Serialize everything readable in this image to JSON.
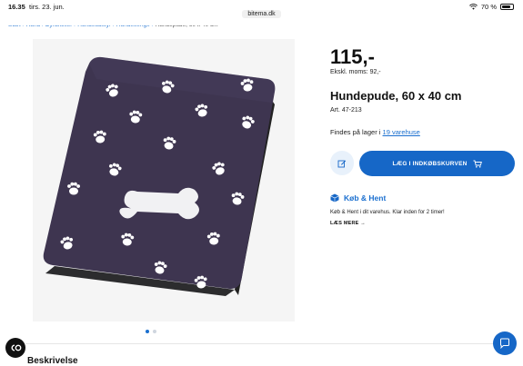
{
  "statusbar": {
    "time": "16.35",
    "date": "tirs. 23. jun.",
    "battery": "70 %"
  },
  "browser": {
    "domain": "bitema.dk"
  },
  "breadcrumb": {
    "items": [
      "Start",
      "Hund",
      "Dyrartikler",
      "Hundeudstyr",
      "Hundesenge"
    ],
    "current": "Hundepude, 60 x 40 cm"
  },
  "gallery": {
    "pages": 2,
    "active": 1
  },
  "product": {
    "price": "115,-",
    "ex_moms_label": "Ekskl. moms:",
    "ex_moms_value": "92,-",
    "title": "Hundepude, 60 x 40 cm",
    "art_label": "Art. 47-213",
    "stock_text": "Findes på lager i",
    "stock_link": "19 varehuse"
  },
  "actions": {
    "add_to_cart": "LÆG I INDKØBSKURVEN"
  },
  "click_collect": {
    "title": "Køb & Hent",
    "description": "Køb & Hent i dit varehus. Klar inden for 2 timer!",
    "read_more": "LÆS MERE"
  },
  "sections": {
    "description_title": "Beskrivelse"
  },
  "floating": {
    "co_label": "CO"
  },
  "colors": {
    "accent": "#1667c7",
    "cushion": "#3e3550",
    "paw": "#ffffff"
  }
}
